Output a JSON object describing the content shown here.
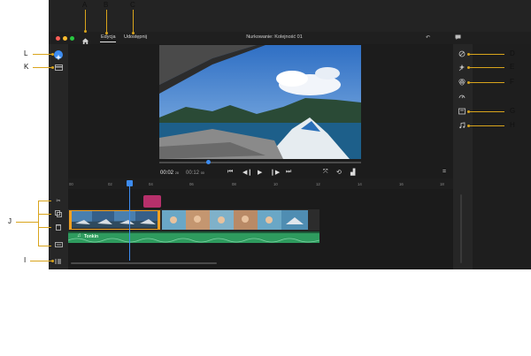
{
  "header": {
    "tabs": [
      {
        "label": "Edycja",
        "active": true
      },
      {
        "label": "Udostępnij",
        "active": false
      }
    ],
    "project_title": "Nurkowanie: Kolejność 01"
  },
  "playback": {
    "current_time": "00:02",
    "current_frames": "28",
    "total_time": "00:12",
    "total_frames": "00"
  },
  "ruler_ticks": [
    "00",
    "02",
    "04",
    "06",
    "08",
    "10",
    "12",
    "14",
    "16",
    "18"
  ],
  "audio_clip": {
    "label": "Tonkin"
  },
  "callouts": [
    "A",
    "B",
    "C",
    "D",
    "E",
    "F",
    "G",
    "H",
    "J",
    "I",
    "K",
    "L"
  ],
  "colors": {
    "accent": "#3d8cf0",
    "callout_line": "#d9a41c",
    "audio_track": "#2e9b5e",
    "marker": "#b6306b",
    "clip_border": "#f0a020"
  }
}
